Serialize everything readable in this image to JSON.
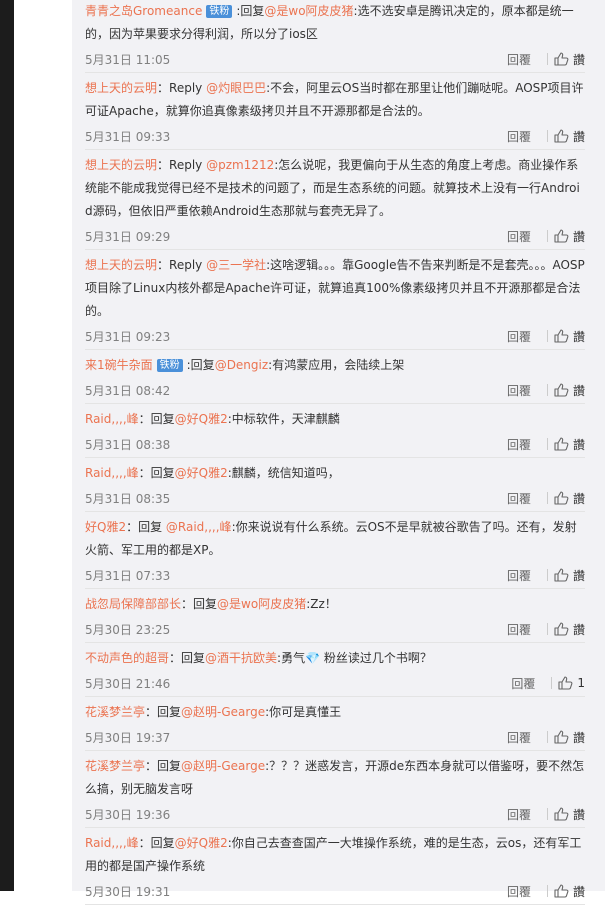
{
  "ui": {
    "reply_label": "回覆",
    "like_label": "讚"
  },
  "comments": [
    {
      "user": "青青之岛Gromeance",
      "badge": "铁粉",
      "connector": ":回复",
      "mention": "@是wo阿皮皮猪",
      "text": ":选不选安卓是腾讯决定的，原本都是统一的，因为苹果要求分得利润，所以分了ios区",
      "time": "5月31日 11:05",
      "likes": ""
    },
    {
      "user": "想上天的云明",
      "badge": "",
      "connector": "：Reply ",
      "mention": "@灼眼巴巴",
      "text": ":不会，阿里云OS当时都在那里让他们蹦哒呢。AOSP项目许可证Apache，就算你追真像素级拷贝并且不开源那都是合法的。",
      "time": "5月31日 09:33",
      "likes": ""
    },
    {
      "user": "想上天的云明",
      "badge": "",
      "connector": "：Reply ",
      "mention": "@pzm1212",
      "text": ":怎么说呢，我更偏向于从生态的角度上考虑。商业操作系统能不能成我觉得已经不是技术的问题了，而是生态系统的问题。就算技术上没有一行Android源码，但依旧严重依赖Android生态那就与套壳无异了。",
      "time": "5月31日 09:29",
      "likes": ""
    },
    {
      "user": "想上天的云明",
      "badge": "",
      "connector": "：Reply ",
      "mention": "@三一学社",
      "text": ":这啥逻辑。。。靠Google告不告来判断是不是套壳。。。AOSP项目除了Linux内核外都是Apache许可证，就算追真100%像素级拷贝并且不开源那都是合法的。",
      "time": "5月31日 09:23",
      "likes": ""
    },
    {
      "user": "来1碗牛杂面",
      "badge": "铁粉",
      "connector": ":回复",
      "mention": "@Dengiz",
      "text": ":有鸿蒙应用，会陆续上架",
      "time": "5月31日 08:42",
      "likes": ""
    },
    {
      "user": "Raid,,,,峰",
      "badge": "",
      "connector": "：回复",
      "mention": "@好Q雅2",
      "text": ":中标软件，天津麒麟",
      "time": "5月31日 08:38",
      "likes": ""
    },
    {
      "user": "Raid,,,,峰",
      "badge": "",
      "connector": "：回复",
      "mention": "@好Q雅2",
      "text": ":麒麟，统信知道吗，",
      "time": "5月31日 08:35",
      "likes": ""
    },
    {
      "user": "好Q雅2",
      "badge": "",
      "connector": "：回复 ",
      "mention": "@Raid,,,,峰",
      "text": ":你来说说有什么系统。云OS不是早就被谷歌告了吗。还有，发射火箭、军工用的都是XP。",
      "time": "5月31日 07:33",
      "likes": ""
    },
    {
      "user": "战忽局保障部部长",
      "badge": "",
      "connector": "：回复",
      "mention": "@是wo阿皮皮猪",
      "text": ":Zz！",
      "time": "5月30日 23:25",
      "likes": ""
    },
    {
      "user": "不动声色的超哥",
      "badge": "",
      "connector": "：回复",
      "mention": "@酒干抗欧美",
      "text": ":勇气💎 粉丝读过几个书啊？",
      "time": "5月30日 21:46",
      "likes": "1"
    },
    {
      "user": "花溪梦兰亭",
      "badge": "",
      "connector": "：回复",
      "mention": "@赵明-Gearge",
      "text": ":你可是真懂王",
      "time": "5月30日 19:37",
      "likes": ""
    },
    {
      "user": "花溪梦兰亭",
      "badge": "",
      "connector": "：回复",
      "mention": "@赵明-Gearge",
      "text": ":？？？迷惑发言，开源de东西本身就可以借鉴呀，要不然怎么搞，别无脑发言呀",
      "time": "5月30日 19:36",
      "likes": ""
    },
    {
      "user": "Raid,,,,峰",
      "badge": "",
      "connector": "：回复",
      "mention": "@好Q雅2",
      "text": ":你自己去查查国产一大堆操作系统，难的是生态，云os，还有军工用的都是国产操作系统",
      "time": "5月30日 19:31",
      "likes": ""
    }
  ]
}
